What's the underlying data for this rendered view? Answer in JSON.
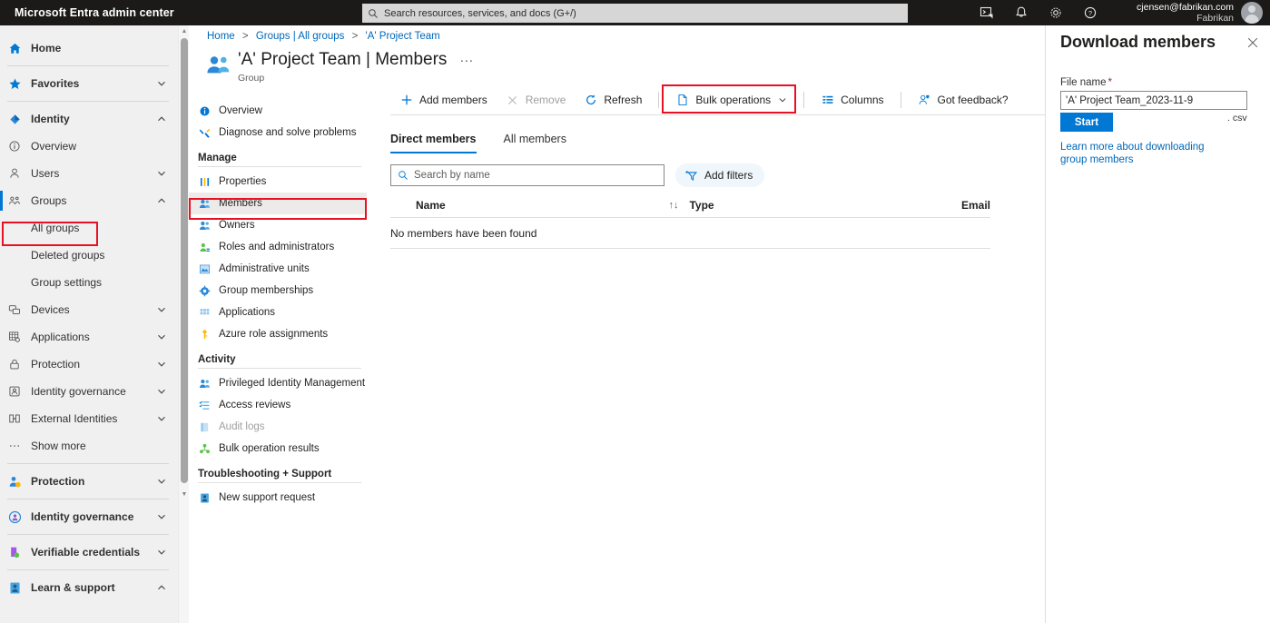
{
  "topbar": {
    "brand": "Microsoft Entra admin center",
    "search_placeholder": "Search resources, services, and docs (G+/)",
    "icons": [
      "cloud-shell-icon",
      "notifications-bell-icon",
      "settings-gear-icon",
      "help-question-icon"
    ],
    "account_email": "cjensen@fabrikan.com",
    "account_org": "Fabrikan"
  },
  "leftnav": {
    "items": [
      {
        "label": "Home",
        "icon": "home-icon",
        "chevron": "",
        "bold": true
      },
      {
        "label": "Favorites",
        "icon": "star-icon",
        "chevron": "down",
        "bold": true
      },
      {
        "label": "Identity",
        "icon": "identity-diamond-icon",
        "chevron": "up",
        "bold": true
      },
      {
        "label": "Overview",
        "icon": "info-circle-icon",
        "chevron": "",
        "bold": false
      },
      {
        "label": "Users",
        "icon": "user-icon",
        "chevron": "down",
        "bold": false
      },
      {
        "label": "Groups",
        "icon": "groups-icon",
        "chevron": "up",
        "bold": false
      },
      {
        "label": "Devices",
        "icon": "devices-icon",
        "chevron": "down",
        "bold": false
      },
      {
        "label": "Applications",
        "icon": "applications-grid-icon",
        "chevron": "down",
        "bold": false
      },
      {
        "label": "Protection",
        "icon": "lock-icon",
        "chevron": "down",
        "bold": false
      },
      {
        "label": "Identity governance",
        "icon": "governance-icon",
        "chevron": "down",
        "bold": false
      },
      {
        "label": "External Identities",
        "icon": "external-identities-icon",
        "chevron": "down",
        "bold": false
      },
      {
        "label": "Show more",
        "icon": "ellipsis-icon",
        "chevron": "",
        "bold": false
      }
    ],
    "groups_children": [
      "All groups",
      "Deleted groups",
      "Group settings"
    ],
    "bottom_items": [
      {
        "label": "Protection",
        "icon": "protection-person-icon",
        "chevron": "down"
      },
      {
        "label": "Identity governance",
        "icon": "identity-governance-circle-icon",
        "chevron": "down"
      },
      {
        "label": "Verifiable credentials",
        "icon": "verifiable-credentials-icon",
        "chevron": "down"
      },
      {
        "label": "Learn & support",
        "icon": "learn-support-icon",
        "chevron": "up"
      }
    ],
    "selected_child": "All groups"
  },
  "resource_menu": {
    "top_items": [
      {
        "label": "Overview",
        "icon": "overview-info-icon",
        "state": "normal"
      },
      {
        "label": "Diagnose and solve problems",
        "icon": "diagnose-wrench-icon",
        "state": "normal"
      }
    ],
    "sections": [
      {
        "header": "Manage",
        "items": [
          {
            "label": "Properties",
            "icon": "properties-sliders-icon",
            "state": "normal"
          },
          {
            "label": "Members",
            "icon": "members-people-icon",
            "state": "selected"
          },
          {
            "label": "Owners",
            "icon": "owners-people-icon",
            "state": "normal"
          },
          {
            "label": "Roles and administrators",
            "icon": "roles-admin-icon",
            "state": "normal"
          },
          {
            "label": "Administrative units",
            "icon": "administrative-units-icon",
            "state": "normal"
          },
          {
            "label": "Group memberships",
            "icon": "group-memberships-gear-icon",
            "state": "normal"
          },
          {
            "label": "Applications",
            "icon": "applications-grid-icon",
            "state": "normal"
          },
          {
            "label": "Azure role assignments",
            "icon": "azure-role-key-icon",
            "state": "normal"
          }
        ]
      },
      {
        "header": "Activity",
        "items": [
          {
            "label": "Privileged Identity Management",
            "icon": "pim-people-icon",
            "state": "normal"
          },
          {
            "label": "Access reviews",
            "icon": "access-reviews-list-icon",
            "state": "normal"
          },
          {
            "label": "Audit logs",
            "icon": "audit-logs-icon",
            "state": "disabled"
          },
          {
            "label": "Bulk operation results",
            "icon": "bulk-operation-results-icon",
            "state": "normal"
          }
        ]
      },
      {
        "header": "Troubleshooting + Support",
        "items": [
          {
            "label": "New support request",
            "icon": "support-request-person-icon",
            "state": "normal"
          }
        ]
      }
    ]
  },
  "main": {
    "breadcrumb": [
      "Home",
      "Groups | All groups",
      "'A' Project Team"
    ],
    "page_title": "'A' Project Team | Members",
    "page_subtitle": "Group",
    "page_overflow": "···",
    "collapse_chevron": "«",
    "commands": [
      {
        "label": "Add members",
        "icon": "plus-icon",
        "state": "normal",
        "chevron": false
      },
      {
        "label": "Remove",
        "icon": "close-x-icon",
        "state": "disabled",
        "chevron": false
      },
      {
        "label": "Refresh",
        "icon": "refresh-icon",
        "state": "normal",
        "chevron": false
      },
      {
        "label": "Bulk operations",
        "icon": "document-page-icon",
        "state": "highlighted",
        "chevron": true
      },
      {
        "label": "Columns",
        "icon": "columns-icon",
        "state": "normal",
        "chevron": false
      },
      {
        "label": "Got feedback?",
        "icon": "feedback-person-icon",
        "state": "normal",
        "chevron": false
      }
    ],
    "tabs": [
      {
        "label": "Direct members",
        "active": true
      },
      {
        "label": "All members",
        "active": false
      }
    ],
    "search_placeholder": "Search by name",
    "add_filters_label": "Add filters",
    "table": {
      "columns": [
        "Name",
        "Type",
        "Email"
      ],
      "sort_glyph": "↑↓",
      "rows": [],
      "empty_message": "No members have been found"
    }
  },
  "right_panel": {
    "title": "Download members",
    "close_icon": "close-x-icon",
    "file_name_label": "File name",
    "required_marker": "*",
    "file_name_value": "'A' Project Team_2023-11-9",
    "extension_label": ". csv",
    "start_button": "Start",
    "learn_more_link": "Learn more about downloading group members"
  },
  "colors": {
    "topbar_bg": "#1b1a19",
    "accent_blue": "#0078d4",
    "link_blue": "#0067b8",
    "highlight_red": "#e81123",
    "sidebar_bg": "#f0f0f0",
    "selected_row_bg": "#edebe9"
  }
}
